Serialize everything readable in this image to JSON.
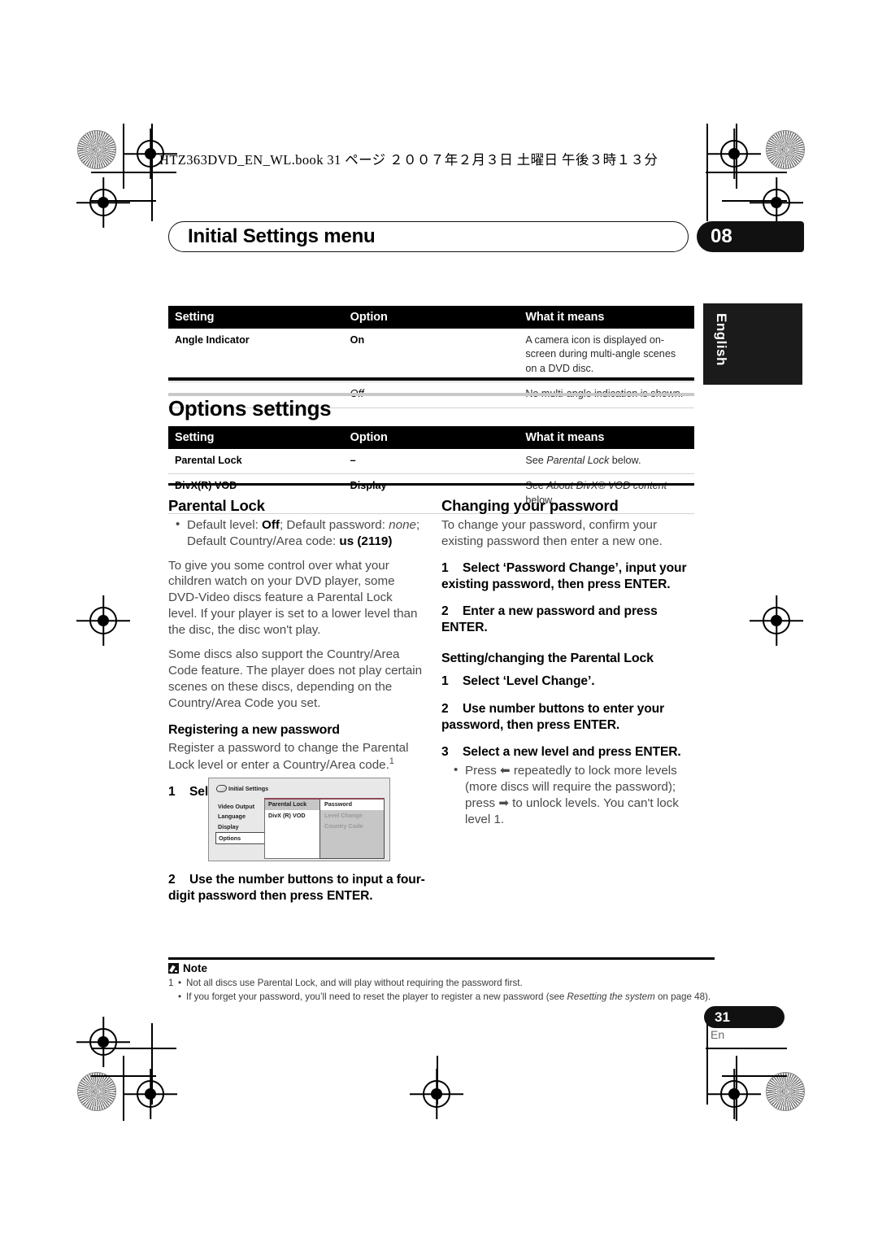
{
  "book_header": "HTZ363DVD_EN_WL.book  31 ページ  ２００７年２月３日  土曜日  午後３時１３分",
  "header": {
    "title": "Initial Settings menu",
    "chapter": "08",
    "language_tab": "English"
  },
  "table_angle": {
    "columns": [
      "Setting",
      "Option",
      "What it means"
    ],
    "rows": [
      {
        "setting": "Angle Indicator",
        "option": "On",
        "option_italic": false,
        "means": "A camera icon is displayed on-screen during multi-angle scenes on a DVD disc."
      },
      {
        "setting": "",
        "option": "Off",
        "option_italic": true,
        "means": "No multi-angle indication is shown."
      }
    ]
  },
  "options_heading": "Options settings",
  "table_options": {
    "columns": [
      "Setting",
      "Option",
      "What it means"
    ],
    "rows": [
      {
        "setting": "Parental Lock",
        "option": "–",
        "means_prefix": "See ",
        "means_italic": "Parental Lock",
        "means_suffix": " below."
      },
      {
        "setting": "DivX(R) VOD",
        "option": "Display",
        "means_prefix": "See ",
        "means_italic": "About DivX® VOD content",
        "means_suffix": " below."
      }
    ]
  },
  "left_column": {
    "heading": "Parental Lock",
    "bullet_default": {
      "p1": "Default level: ",
      "b1": "Off",
      "p2": "; Default password: ",
      "i1": "none",
      "p3": "; Default Country/Area code: ",
      "b2": "us (2119)"
    },
    "para1": "To give you some control over what your children watch on your DVD player, some DVD-Video discs feature a Parental Lock level. If your player is set to a lower level than the disc, the disc won't play.",
    "para2": "Some discs also support the Country/Area Code feature. The player does not play certain scenes on these discs, depending on the Country/Area Code you set.",
    "subheading": "Registering a new password",
    "para3_a": "Register a password to change the Parental Lock level or enter a Country/Area code.",
    "para3_fn": "1",
    "step1_num": "1",
    "step1_text": "Select ‘Password’.",
    "step2_num": "2",
    "step2_text": "Use the number buttons to input a four-digit password then press ENTER."
  },
  "right_column": {
    "heading": "Changing your password",
    "para1": "To change your password, confirm your existing password then enter a new one.",
    "step1_num": "1",
    "step1_text": "Select ‘Password Change’, input your existing password, then press ENTER.",
    "step2_num": "2",
    "step2_text": "Enter a new password and press ENTER.",
    "subheading": "Setting/changing the Parental Lock",
    "step3_num": "1",
    "step3_text": "Select ‘Level Change’.",
    "step4_num": "2",
    "step4_text": "Use number buttons to enter your password, then press ENTER.",
    "step5_num": "3",
    "step5_text": "Select a new level and press ENTER.",
    "sub_bullet_a": "Press ",
    "sub_bullet_arrow_left": "⬅",
    "sub_bullet_b": " repeatedly to lock more levels (more discs will require the password); press ",
    "sub_bullet_arrow_right": "➡",
    "sub_bullet_c": " to unlock levels. You can't lock level 1."
  },
  "osd_figure": {
    "title": "Initial Settings",
    "left_menu": [
      "Video Output",
      "Language",
      "Display",
      "Options"
    ],
    "left_selected": "Options",
    "mid_menu": [
      "Parental Lock",
      "DivX (R) VOD"
    ],
    "mid_selected": "Parental Lock",
    "right_menu": [
      "Password",
      "Level Change",
      "Country Code"
    ],
    "right_selected": "Password",
    "accent_color": "#8e4a58"
  },
  "note": {
    "label": "Note",
    "items": [
      {
        "marker": "1",
        "text": "Not all discs use Parental Lock, and will play without requiring the password first."
      },
      {
        "marker": "",
        "prefix": "If you forget your password, you’ll need to reset the player to register a new password (see ",
        "italic": "Resetting the system",
        "suffix": " on page 48)."
      }
    ]
  },
  "footer": {
    "page": "31",
    "lang": "En"
  }
}
